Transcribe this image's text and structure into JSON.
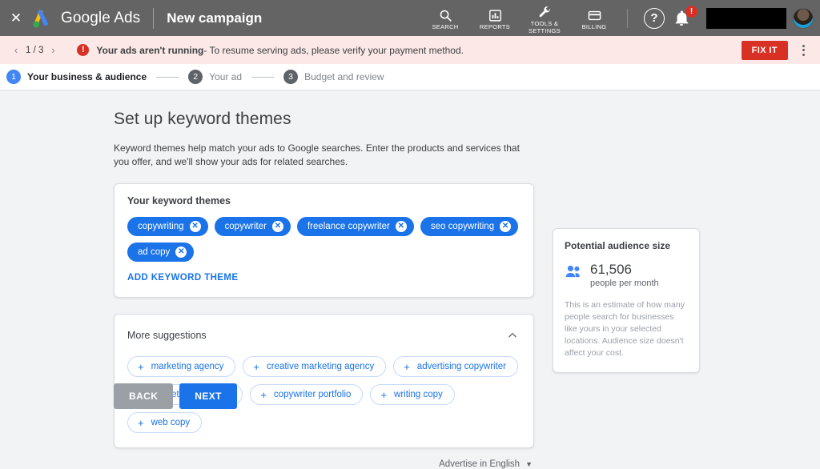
{
  "topbar": {
    "close_label": "✕",
    "brand": "Google Ads",
    "page_title": "New campaign",
    "nav": [
      {
        "icon": "search-icon",
        "label": "SEARCH"
      },
      {
        "icon": "reports-icon",
        "label": "REPORTS"
      },
      {
        "icon": "tools-settings-icon",
        "label": "TOOLS &\nSETTINGS"
      },
      {
        "icon": "billing-icon",
        "label": "BILLING"
      }
    ],
    "help_label": "?",
    "notification_badge": "!",
    "account_redacted": ""
  },
  "alert": {
    "prev_arrow": "‹",
    "page_count": "1 / 3",
    "next_arrow": "›",
    "error_glyph": "!",
    "headline": "Your ads aren't running",
    "detail": " - To resume serving ads, please verify your payment method.",
    "fix_label": "FIX IT"
  },
  "stepper": {
    "steps": [
      {
        "num": "1",
        "label": "Your business & audience",
        "state": "active"
      },
      {
        "num": "2",
        "label": "Your ad",
        "state": "idle"
      },
      {
        "num": "3",
        "label": "Budget and review",
        "state": "idle"
      }
    ]
  },
  "main": {
    "heading": "Set up keyword themes",
    "description": "Keyword themes help match your ads to Google searches. Enter the products and services that you offer, and we'll show your ads for related searches.",
    "keyword_card": {
      "title": "Your keyword themes",
      "chips": [
        {
          "label": "copywriting",
          "remove": "✕"
        },
        {
          "label": "copywriter",
          "remove": "✕"
        },
        {
          "label": "freelance copywriter",
          "remove": "✕"
        },
        {
          "label": "seo copywriting",
          "remove": "✕"
        },
        {
          "label": "ad copy",
          "remove": "✕"
        }
      ],
      "add_label": "ADD KEYWORD THEME"
    },
    "suggestions_card": {
      "title": "More suggestions",
      "collapse_icon": "chevron-up-icon",
      "chips": [
        {
          "label": "marketing agency",
          "add": "+"
        },
        {
          "label": "creative marketing agency",
          "add": "+"
        },
        {
          "label": "advertising copywriter",
          "add": "+"
        },
        {
          "label": "marketing agencies",
          "add": "+"
        },
        {
          "label": "copywriter portfolio",
          "add": "+"
        },
        {
          "label": "writing copy",
          "add": "+"
        },
        {
          "label": "web copy",
          "add": "+"
        }
      ]
    },
    "language": {
      "label": "Advertise in English",
      "caret": "▼"
    },
    "buttons": {
      "back": "BACK",
      "next": "NEXT"
    }
  },
  "sidebar": {
    "title": "Potential audience size",
    "audience_number": "61,506",
    "audience_unit": "people per month",
    "note": "This is an estimate of how many people search for businesses like yours in your selected locations. Audience size doesn't affect your cost."
  },
  "colors": {
    "blue": "#1a73e8",
    "step_blue": "#4285f4",
    "red": "#d93025",
    "alert_bg": "#fce8e6",
    "topbar": "#646464",
    "page_bg": "#f1f3f4"
  }
}
